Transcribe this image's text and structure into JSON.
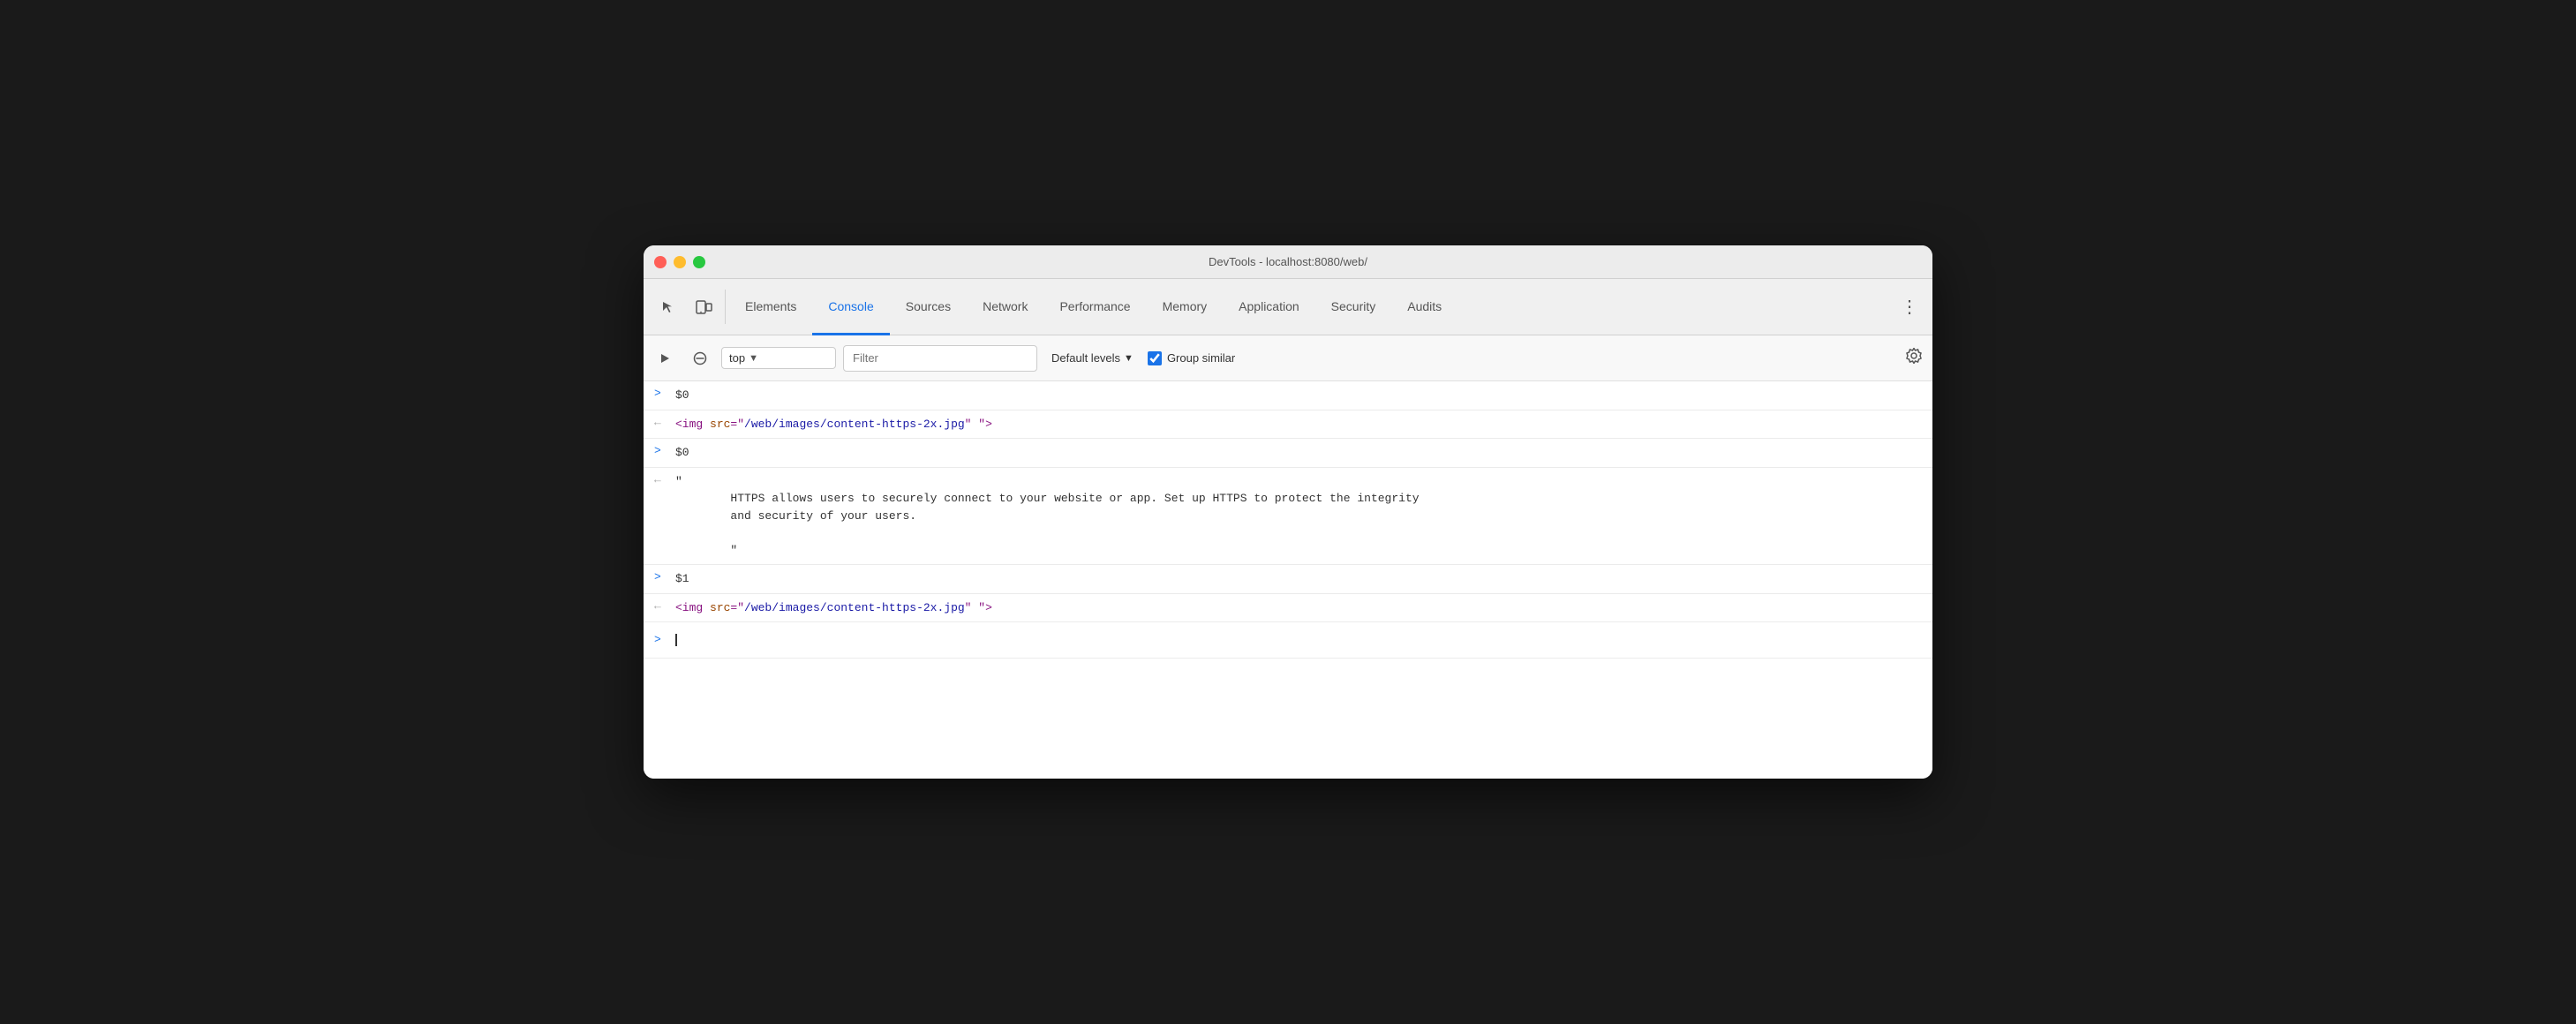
{
  "window": {
    "title": "DevTools - localhost:8080/web/",
    "traffic_lights": [
      "red",
      "yellow",
      "green"
    ]
  },
  "tabs": {
    "items": [
      {
        "label": "Elements",
        "active": false
      },
      {
        "label": "Console",
        "active": true
      },
      {
        "label": "Sources",
        "active": false
      },
      {
        "label": "Network",
        "active": false
      },
      {
        "label": "Performance",
        "active": false
      },
      {
        "label": "Memory",
        "active": false
      },
      {
        "label": "Application",
        "active": false
      },
      {
        "label": "Security",
        "active": false
      },
      {
        "label": "Audits",
        "active": false
      }
    ],
    "more_label": "⋮"
  },
  "toolbar": {
    "context": "top",
    "context_arrow": "▼",
    "filter_placeholder": "Filter",
    "levels_label": "Default levels",
    "levels_arrow": "▼",
    "group_similar_label": "Group similar"
  },
  "console": {
    "entries": [
      {
        "type": "input",
        "chevron": ">",
        "text": "$0"
      },
      {
        "type": "output",
        "chevron": "←",
        "html_tag": "img",
        "attr_name": "src",
        "attr_value": "/web/images/content-https-2x.jpg",
        "attr_rest": "\" \">",
        "prefix": "<",
        "suffix": ""
      },
      {
        "type": "input",
        "chevron": ">",
        "text": "$0"
      },
      {
        "type": "output-multiline",
        "chevron": "←",
        "quote_open": "\"",
        "text_content": "\n        HTTPS allows users to securely connect to your website or app. Set up HTTPS to protect the integrity\n        and security of your users.\n\n        \"",
        "quote_close": ""
      },
      {
        "type": "input",
        "chevron": ">",
        "text": "$1"
      },
      {
        "type": "output",
        "chevron": "←",
        "html_tag": "img",
        "attr_name": "src",
        "attr_value": "/web/images/content-https-2x.jpg",
        "attr_rest": "\" \">",
        "prefix": "<",
        "suffix": ""
      }
    ],
    "input_chevron": ">",
    "input_cursor": "|"
  },
  "icons": {
    "inspect": "⬚",
    "device": "☐",
    "execute": "▶",
    "clear": "⊘",
    "gear": "⚙"
  }
}
